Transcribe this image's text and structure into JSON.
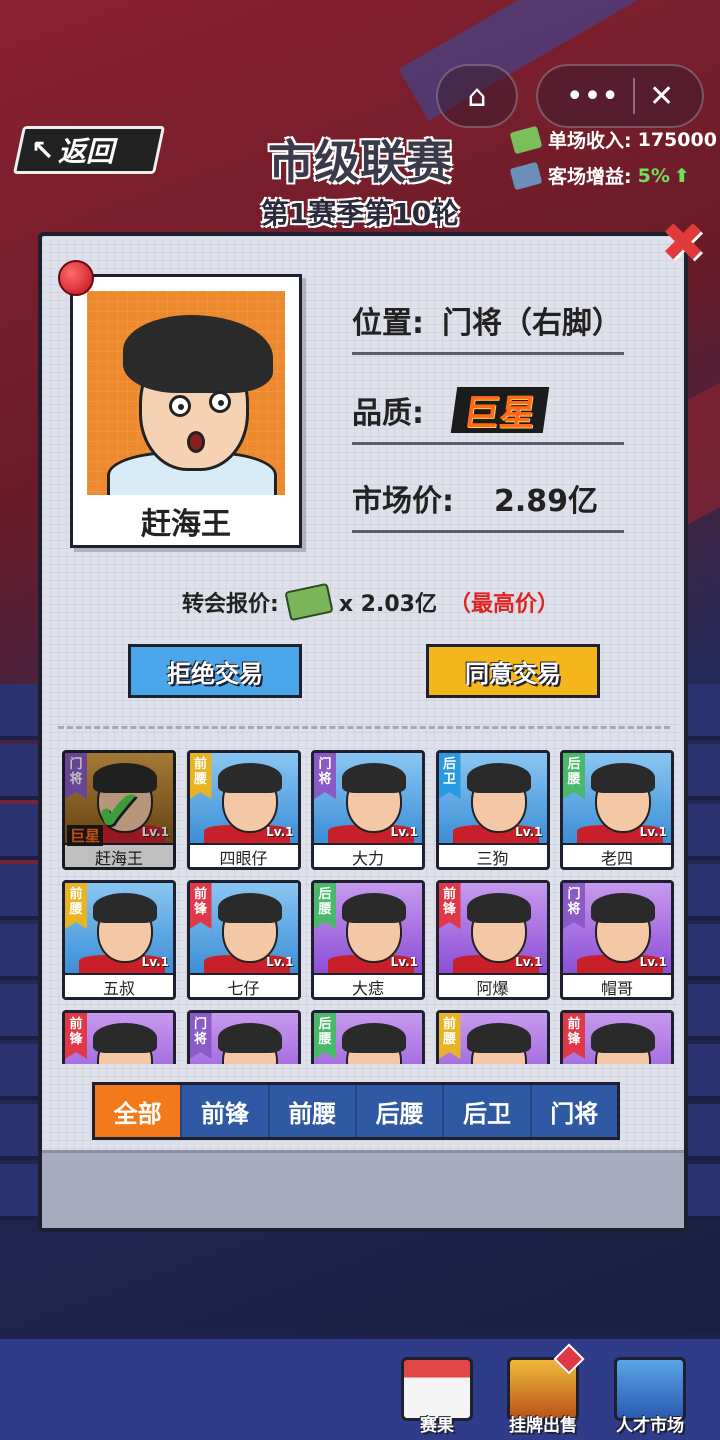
{
  "header": {
    "back_label": "返回",
    "title": "市级联赛",
    "subtitle": "第1赛季第10轮",
    "income_label": "单场收入:",
    "income_value": "175000",
    "away_label": "客场增益:",
    "away_value": "5%"
  },
  "player": {
    "name": "赶海王",
    "position_label": "位置:",
    "position_value": "门将（右脚）",
    "quality_label": "品质:",
    "quality_value": "巨星",
    "market_label": "市场价:",
    "market_value": "2.89亿"
  },
  "offer": {
    "label": "转会报价:",
    "amount": "x 2.03亿",
    "tag": "（最高价）"
  },
  "actions": {
    "reject": "拒绝交易",
    "accept": "同意交易"
  },
  "roster": [
    {
      "pos": "门将",
      "name": "赶海王",
      "lv": "Lv.1",
      "color": "gold",
      "selected": true,
      "quality": "巨星"
    },
    {
      "pos": "前腰",
      "name": "四眼仔",
      "lv": "Lv.1",
      "color": "blue"
    },
    {
      "pos": "门将",
      "name": "大力",
      "lv": "Lv.1",
      "color": "blue"
    },
    {
      "pos": "后卫",
      "name": "三狗",
      "lv": "Lv.1",
      "color": "blue"
    },
    {
      "pos": "后腰",
      "name": "老四",
      "lv": "Lv.1",
      "color": "blue"
    },
    {
      "pos": "前腰",
      "name": "五叔",
      "lv": "Lv.1",
      "color": "blue"
    },
    {
      "pos": "前锋",
      "name": "七仔",
      "lv": "Lv.1",
      "color": "blue"
    },
    {
      "pos": "后腰",
      "name": "大痣",
      "lv": "Lv.1",
      "color": "purple"
    },
    {
      "pos": "前锋",
      "name": "阿爆",
      "lv": "Lv.1",
      "color": "purple"
    },
    {
      "pos": "门将",
      "name": "帽哥",
      "lv": "Lv.1",
      "color": "purple"
    },
    {
      "pos": "前锋",
      "name": "",
      "lv": "",
      "color": "purple"
    },
    {
      "pos": "门将",
      "name": "",
      "lv": "",
      "color": "purple"
    },
    {
      "pos": "后腰",
      "name": "",
      "lv": "",
      "color": "purple"
    },
    {
      "pos": "前腰",
      "name": "",
      "lv": "",
      "color": "purple"
    },
    {
      "pos": "前锋",
      "name": "",
      "lv": "",
      "color": "purple"
    }
  ],
  "tabs": [
    "全部",
    "前锋",
    "前腰",
    "后腰",
    "后卫",
    "门将"
  ],
  "bottom_nav": {
    "results": "赛果",
    "listing": "挂牌出售",
    "market": "人才市场"
  },
  "colors": {
    "accent_orange": "#f27a1a",
    "reject_blue": "#4aa6e8",
    "accept_yellow": "#f4b61a",
    "highlight_red": "#e02424"
  }
}
